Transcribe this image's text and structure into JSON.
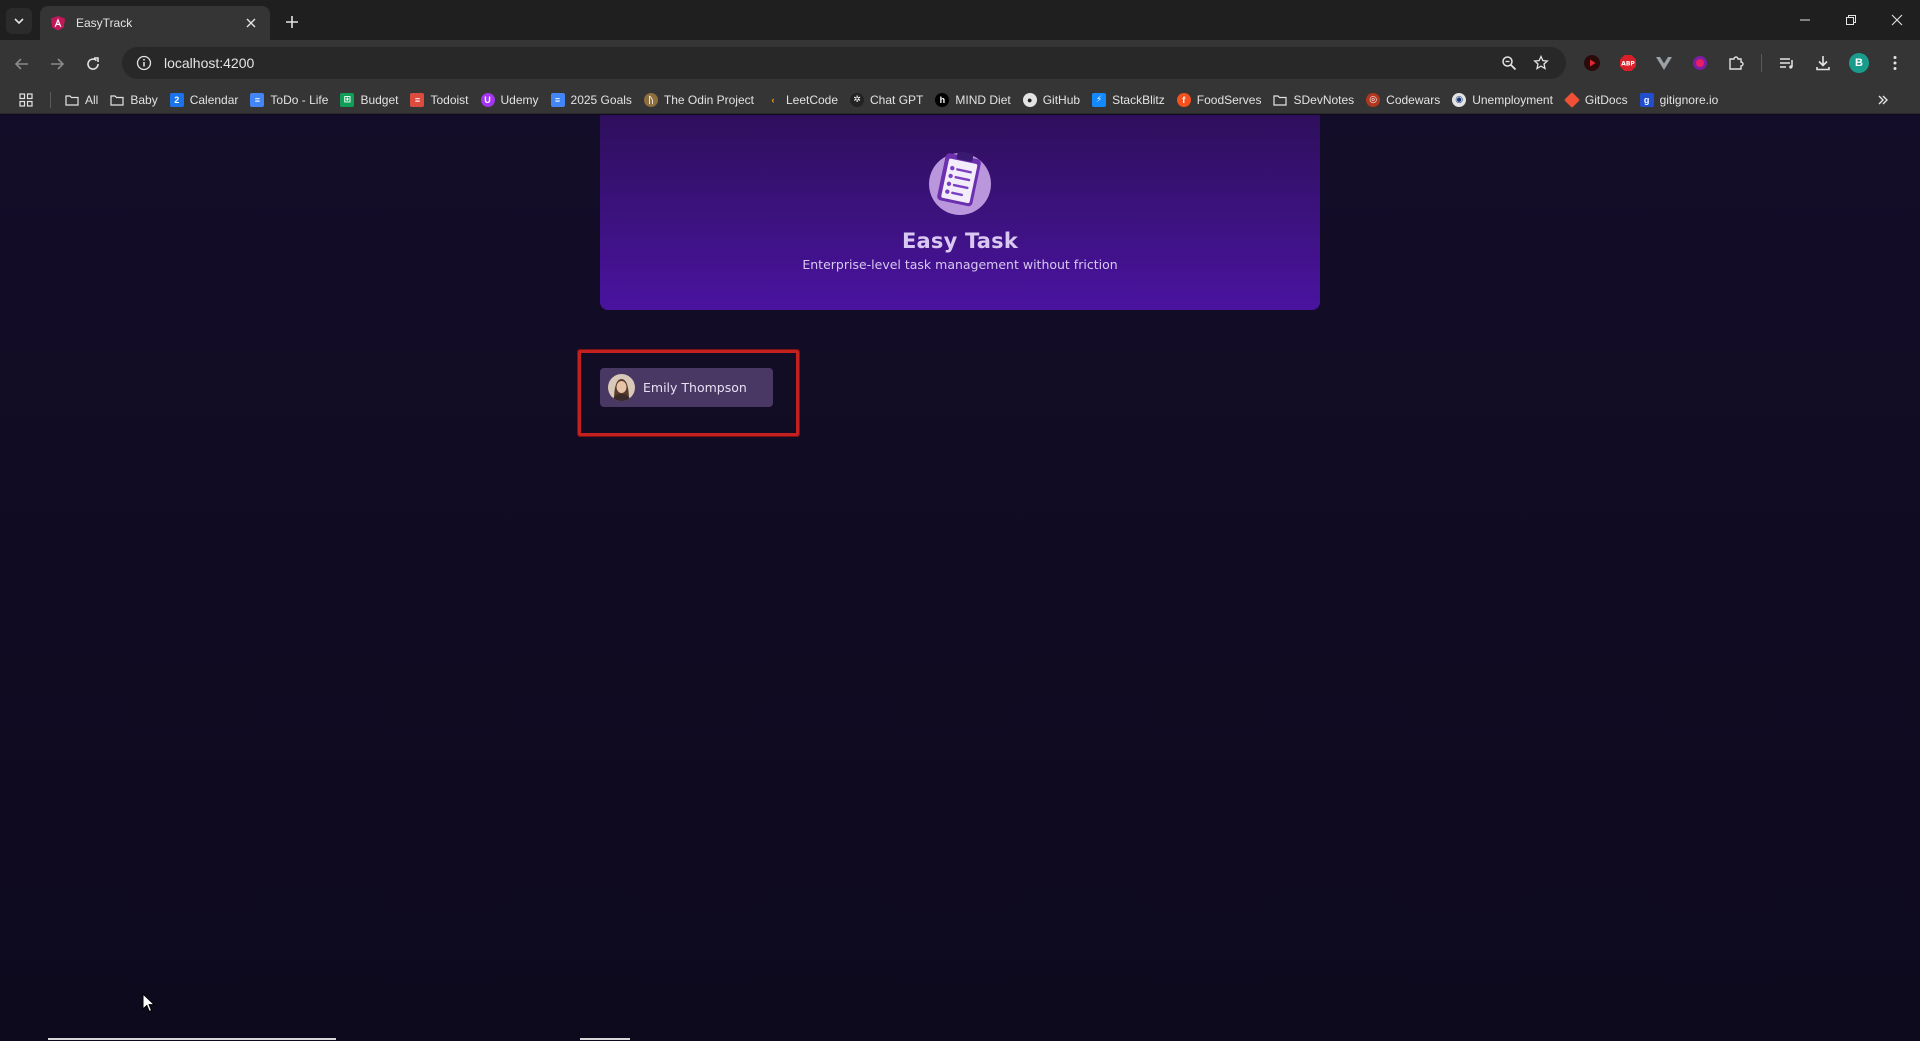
{
  "browser": {
    "tab_title": "EasyTrack",
    "url": "localhost:4200",
    "profile_initial": "B",
    "bookmarks": [
      {
        "label": "All",
        "icon": "folder-icon"
      },
      {
        "label": "Baby",
        "icon": "folder-icon"
      },
      {
        "label": "Calendar",
        "icon": "calendar-icon"
      },
      {
        "label": "ToDo - Life",
        "icon": "docs-icon"
      },
      {
        "label": "Budget",
        "icon": "sheets-icon"
      },
      {
        "label": "Todoist",
        "icon": "todoist-icon"
      },
      {
        "label": "Udemy",
        "icon": "udemy-icon"
      },
      {
        "label": "2025 Goals",
        "icon": "docs-icon"
      },
      {
        "label": "The Odin Project",
        "icon": "odin-icon"
      },
      {
        "label": "LeetCode",
        "icon": "leetcode-icon"
      },
      {
        "label": "Chat GPT",
        "icon": "openai-icon"
      },
      {
        "label": "MIND Diet",
        "icon": "mind-icon"
      },
      {
        "label": "GitHub",
        "icon": "github-icon"
      },
      {
        "label": "StackBlitz",
        "icon": "stackblitz-icon"
      },
      {
        "label": "FoodServes",
        "icon": "foodserves-icon"
      },
      {
        "label": "SDevNotes",
        "icon": "folder-icon"
      },
      {
        "label": "Codewars",
        "icon": "codewars-icon"
      },
      {
        "label": "Unemployment",
        "icon": "unemployment-icon"
      },
      {
        "label": "GitDocs",
        "icon": "git-icon"
      },
      {
        "label": "gitignore.io",
        "icon": "gitignore-icon"
      }
    ]
  },
  "app": {
    "title": "Easy Task",
    "subtitle": "Enterprise-level task management without friction"
  },
  "users": [
    {
      "name": "Emily Thompson"
    }
  ],
  "colors": {
    "page_bg": "#0f0b1e",
    "header_gradient_top": "#2e0f5c",
    "header_gradient_bottom": "#4a13a0",
    "user_button_bg": "#4a3864",
    "highlight_border": "#c42020"
  }
}
